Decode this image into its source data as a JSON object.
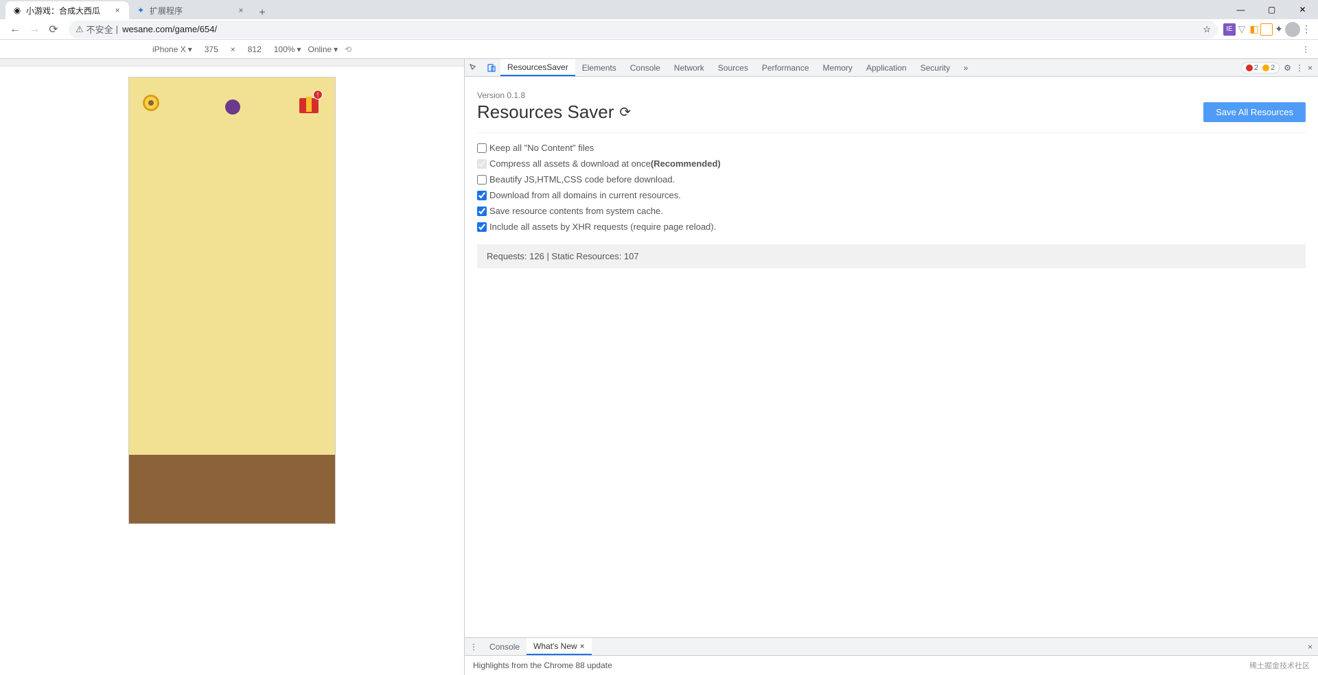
{
  "tabs": [
    {
      "title": "小游戏：合成大西瓜",
      "favicon": "globe"
    },
    {
      "title": "扩展程序",
      "favicon": "puzzle"
    }
  ],
  "window": {
    "minimize": "—",
    "maximize": "▢",
    "close": "✕"
  },
  "nav": {
    "back": "←",
    "forward": "→",
    "reload": "⟳"
  },
  "address": {
    "security_icon": "⚠",
    "security_text": "不安全",
    "url": "wesane.com/game/654/",
    "star": "☆"
  },
  "ext_icons": [
    "v1",
    "v2",
    "v3",
    "v4"
  ],
  "device_bar": {
    "device": "iPhone X",
    "width": "375",
    "height": "812",
    "zoom": "100%",
    "throttle": "Online",
    "more": "⋮"
  },
  "game": {
    "gift_badge": "!"
  },
  "devtools": {
    "tabs": [
      "ResourcesSaver",
      "Elements",
      "Console",
      "Network",
      "Sources",
      "Performance",
      "Memory",
      "Application",
      "Security"
    ],
    "active_tab": "ResourcesSaver",
    "more": "»",
    "errors": "2",
    "warnings": "2",
    "settings": "⚙"
  },
  "panel": {
    "version": "Version 0.1.8",
    "title": "Resources Saver",
    "refresh": "⟳",
    "save_btn": "Save All Resources",
    "opts": {
      "keep_nocontent": "Keep all \"No Content\" files",
      "compress": "Compress all assets & download at once ",
      "compress_rec": "(Recommended)",
      "beautify": "Beautify JS,HTML,CSS code before download.",
      "all_domains": "Download from all domains in current resources.",
      "system_cache": "Save resource contents from system cache.",
      "xhr": "Include all assets by XHR requests (require page reload)."
    },
    "status": "Requests: 126 | Static Resources: 107"
  },
  "drawer": {
    "tabs": {
      "console": "Console",
      "whatsnew": "What's New"
    },
    "close": "×",
    "highlight": "Highlights from the Chrome 88 update",
    "watermark": "稀土掘金技术社区"
  }
}
